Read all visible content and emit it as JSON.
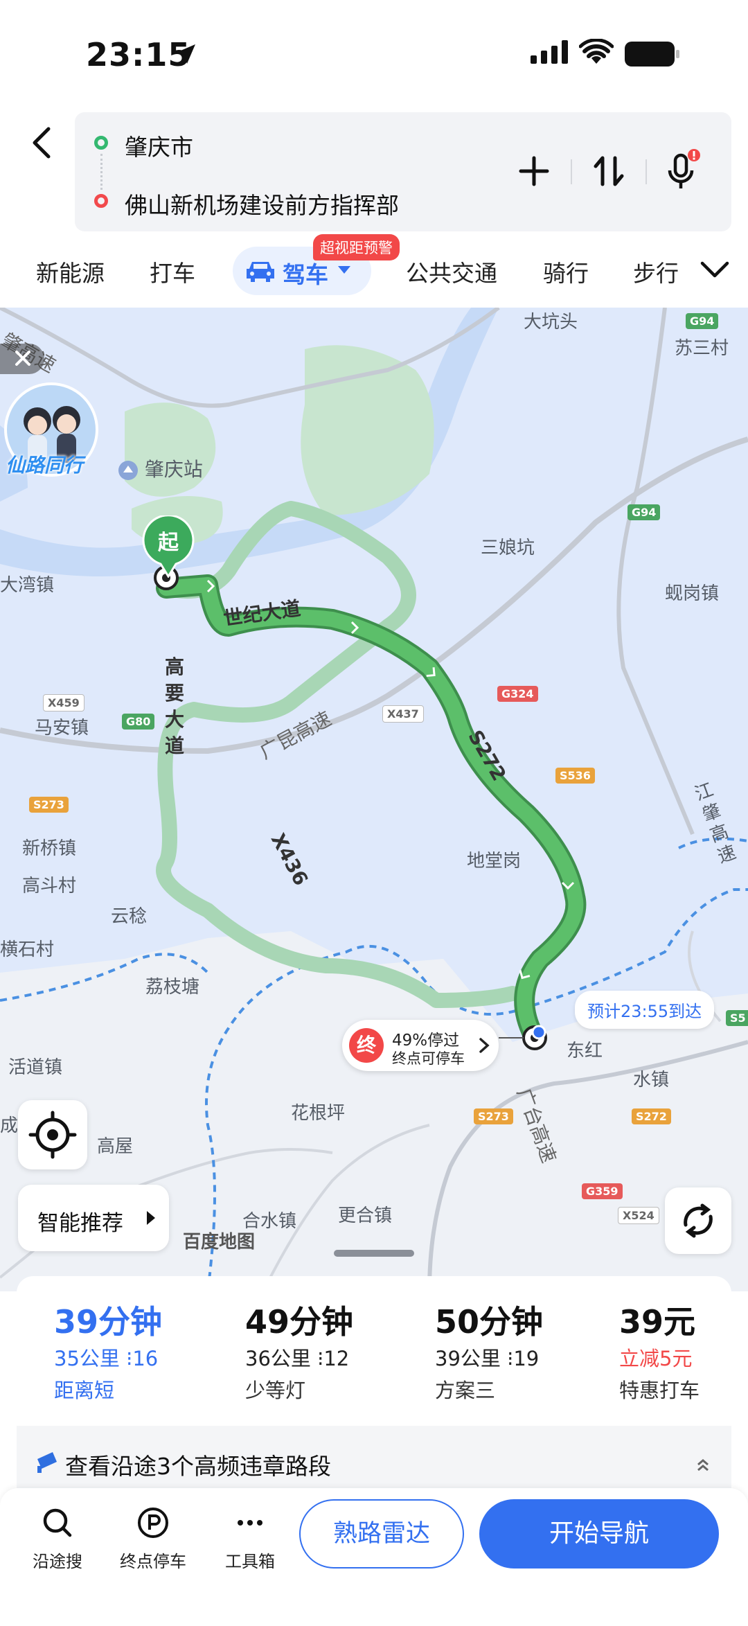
{
  "status_bar": {
    "time": "23:15"
  },
  "route": {
    "origin": "肇庆市",
    "destination": "佛山新机场建设前方指挥部"
  },
  "modes": {
    "tabs": [
      "新能源",
      "打车",
      "驾车",
      "公共交通",
      "骑行",
      "步行"
    ],
    "selected": "驾车",
    "badge": "超视距预警"
  },
  "map": {
    "labels": {
      "dakengtou": "大坑头",
      "susancun": "苏三村",
      "zhaoqing_station": "肇庆站",
      "sanniangkeng": "三娘坑",
      "xiangangzhen": "蚬岗镇",
      "dawanzhen": "大湾镇",
      "maanzhen": "马安镇",
      "xinqiaozhen": "新桥镇",
      "gaodoucun": "高斗村",
      "yunwen": "云稔",
      "hengshicun": "横石村",
      "ditanggang": "地堂岗",
      "lizhitang": "荔枝塘",
      "huodaozhen": "活道镇",
      "donghong": "东红",
      "shuizhen": "水镇",
      "huagenping": "花根坪",
      "gaowu": "高屋",
      "heshuizhen": "合水镇",
      "genghezhen": "更合镇",
      "chengzhen": "成镇",
      "zhizhenzhen": "江\n肇\n高\n速"
    },
    "road_names": {
      "shiji": "世纪大道",
      "gaoyao": "高要大道",
      "guangkun": "广昆高速",
      "s272": "S272",
      "x436": "X436",
      "guangtai": "广台高速",
      "zhaogao": "肇高速"
    },
    "route_tags": [
      "G94",
      "G94",
      "G80",
      "X459",
      "S273",
      "G324",
      "X437",
      "S536",
      "S273",
      "S272",
      "G359",
      "X524",
      "S5"
    ],
    "avatar_label": "仙路同行",
    "start_label": "起",
    "eta": "预计23:55到达",
    "parking": {
      "line1": "49%停过",
      "line2": "终点可停车",
      "end_label": "终"
    },
    "smart_recommend": "智能推荐",
    "logo": "百度地图"
  },
  "plans": [
    {
      "time": "39分钟",
      "detail": "35公里",
      "lights": "16",
      "note": "距离短"
    },
    {
      "time": "49分钟",
      "detail": "36公里",
      "lights": "12",
      "note": "少等灯"
    },
    {
      "time": "50分钟",
      "detail": "39公里",
      "lights": "19",
      "note": "方案三"
    },
    {
      "time": "39元",
      "detail": "立减5元",
      "note": "特惠打车"
    }
  ],
  "violations": "查看沿途3个高频违章路段",
  "bottom_bar": {
    "search": "沿途搜",
    "parking": "终点停车",
    "tools": "工具箱",
    "radar": "熟路雷达",
    "navigate": "开始导航"
  },
  "colors": {
    "accent": "#3370f0",
    "route": "#4db05c",
    "alt_route": "#a8d6b5",
    "water": "#dfe9fb",
    "danger": "#f24848"
  }
}
